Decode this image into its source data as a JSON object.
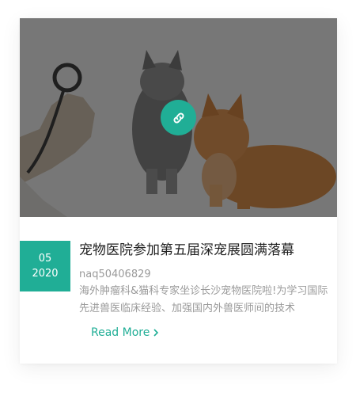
{
  "post": {
    "image_alt": "cats with stethoscope",
    "link_icon": "link-icon",
    "date": {
      "day": "05",
      "year": "2020"
    },
    "title": "宠物医院参加第五届深宠展圆满落幕",
    "author": "naq50406829",
    "excerpt": "海外肿瘤科&猫科专家坐诊长沙宠物医院啦!为学习国际先进兽医临床经验、加强国内外兽医师间的技术",
    "read_more": "Read More",
    "read_more_icon": "chevron-right-icon"
  },
  "colors": {
    "accent": "#20ae96",
    "title": "#222222",
    "muted": "#9a9a9a"
  }
}
